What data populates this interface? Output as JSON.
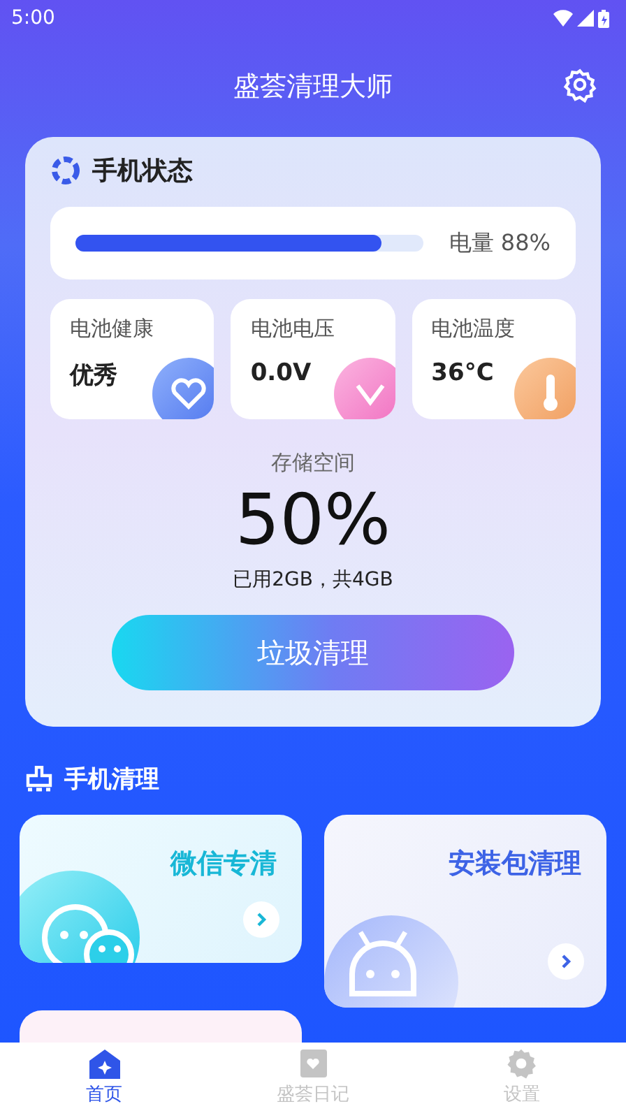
{
  "status_bar": {
    "time": "5:00"
  },
  "header": {
    "title": "盛荟清理大师"
  },
  "phone_status": {
    "title": "手机状态",
    "battery": {
      "level": 0.88,
      "label": "电量 88%"
    },
    "stats": [
      {
        "label": "电池健康",
        "value": "优秀",
        "kind": "health"
      },
      {
        "label": "电池电压",
        "value": "0.0V",
        "kind": "voltage"
      },
      {
        "label": "电池温度",
        "value": "36°C",
        "kind": "temperature"
      }
    ],
    "storage": {
      "label": "存储空间",
      "value": "50%",
      "detail": "已用2GB，共4GB"
    },
    "clean_button": "垃圾清理"
  },
  "phone_clean": {
    "title": "手机清理",
    "tiles": [
      {
        "label": "微信专清",
        "kind": "wechat"
      },
      {
        "label": "安装包清理",
        "kind": "apk"
      },
      {
        "kind": "other"
      }
    ]
  },
  "nav": [
    {
      "label": "首页",
      "selected": true,
      "kind": "home"
    },
    {
      "label": "盛荟日记",
      "selected": false,
      "kind": "diary"
    },
    {
      "label": "设置",
      "selected": false,
      "kind": "settings"
    }
  ]
}
